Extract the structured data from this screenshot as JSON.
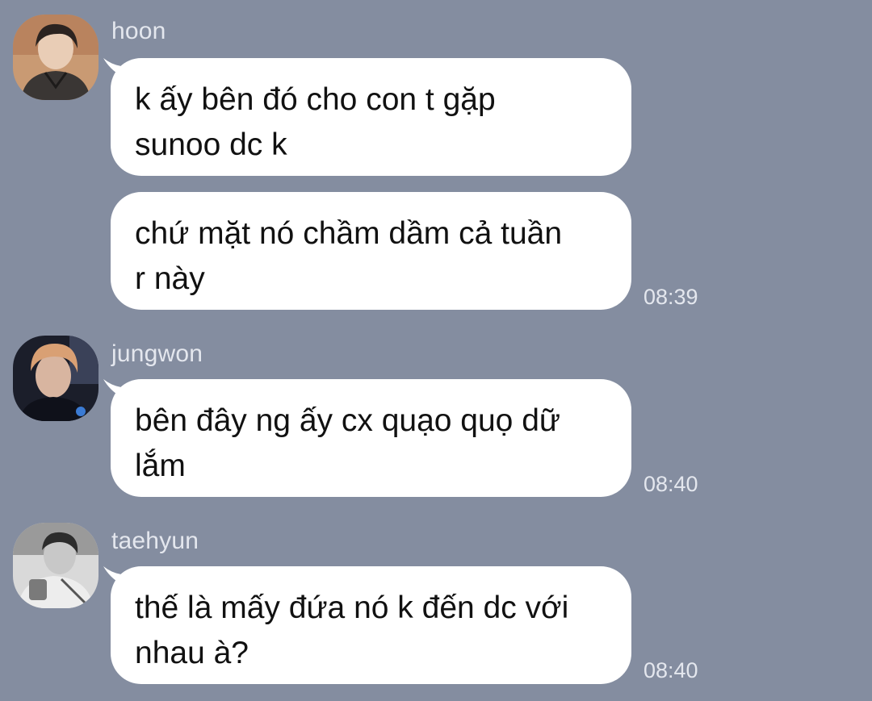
{
  "messages": [
    {
      "sender": "hoon",
      "avatar_icon": "profile-photo-hoon",
      "bubbles": [
        {
          "lines": [
            "k ấy bên đó cho con t gặp",
            "sunoo dc k"
          ]
        },
        {
          "lines": [
            "chứ mặt nó chầm dầm cả tuần",
            "r này"
          ],
          "time": "08:39"
        }
      ]
    },
    {
      "sender": "jungwon",
      "avatar_icon": "profile-photo-jungwon",
      "bubbles": [
        {
          "lines": [
            "bên đây ng ấy cx quạo quọ dữ",
            "lắm"
          ],
          "time": "08:40"
        }
      ]
    },
    {
      "sender": "taehyun",
      "avatar_icon": "profile-photo-taehyun",
      "bubbles": [
        {
          "lines": [
            "thế là mấy đứa nó k đến dc với",
            "nhau à?"
          ],
          "time": "08:40"
        }
      ]
    }
  ],
  "colors": {
    "background": "#848da0",
    "bubble": "#ffffff",
    "meta_text": "#e4e7ee",
    "message_text": "#111111"
  }
}
